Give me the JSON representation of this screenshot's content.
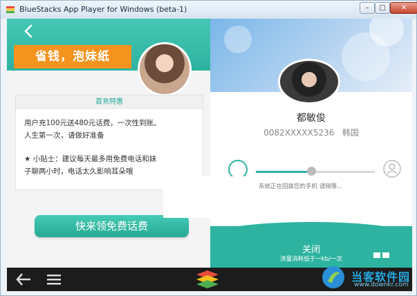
{
  "window": {
    "title": "BlueStacks App Player for Windows (beta-1)",
    "buttons": {
      "minimize": "–",
      "maximize": "□",
      "close": "✕"
    }
  },
  "left_pane": {
    "promo_tag": "省钱，泡妹纸",
    "card_title": "首充特惠",
    "card_lines": [
      "用户充100元送480元话费，一次性到账。",
      "人生第一次，请做好准备",
      "★ 小贴士：建议每天最多用免费电话和妹",
      "子聊两小时，电话太久影响耳朵哦"
    ],
    "cta_label": "快来领免费话费"
  },
  "right_pane": {
    "contact_name": "都敏俊",
    "contact_number": "0082XXXXX5236",
    "contact_country": "韩国",
    "call_progress": 0.43,
    "status_text": "系统正在回拨您的手机 请稍等...",
    "close_label": "关闭",
    "flow_label": "流量消耗低于一kb/一次"
  },
  "watermark": {
    "name": "当客软件园",
    "url": "www.downkr.com"
  },
  "colors": {
    "accent": "#2db3a0",
    "promo": "#f5931f",
    "navbar": "#1c1c1c"
  },
  "icons": [
    "back-arrow-icon",
    "avatar-image",
    "star-icon",
    "person-icon",
    "android-back-icon",
    "android-menu-icon",
    "bluestacks-logo-icon"
  ]
}
